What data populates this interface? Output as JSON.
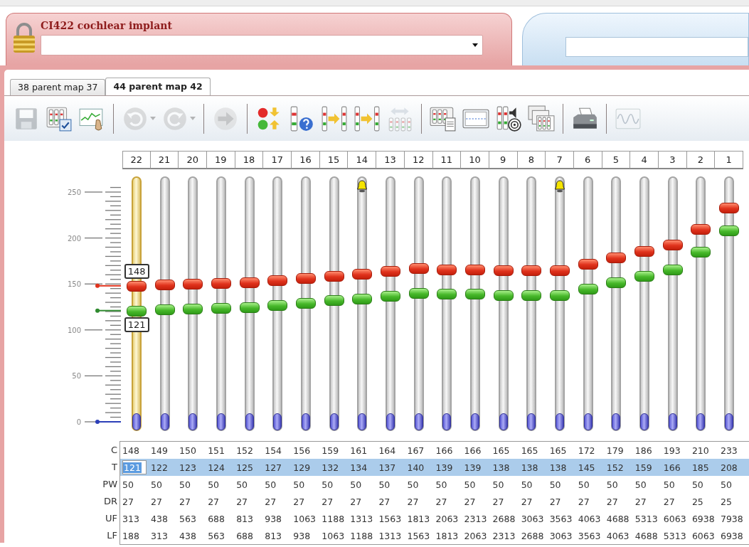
{
  "window": {
    "title": "CI422 cochlear implant"
  },
  "tabs": [
    {
      "label": "38 parent map 37",
      "selected": false
    },
    {
      "label": "44 parent map 42",
      "selected": true
    }
  ],
  "toolbar": [
    {
      "kind": "save",
      "disabled": true
    },
    {
      "kind": "map-check",
      "disabled": false
    },
    {
      "kind": "graph",
      "disabled": false
    },
    {
      "kind": "separator"
    },
    {
      "kind": "undo",
      "disabled": true,
      "menu": true
    },
    {
      "kind": "redo",
      "disabled": true,
      "menu": true
    },
    {
      "kind": "separator"
    },
    {
      "kind": "forward",
      "disabled": true
    },
    {
      "kind": "separator"
    },
    {
      "kind": "levels",
      "disabled": false
    },
    {
      "kind": "slider-help",
      "disabled": false
    },
    {
      "kind": "copy-right",
      "disabled": false
    },
    {
      "kind": "copy-left",
      "disabled": false
    },
    {
      "kind": "spread",
      "disabled": true
    },
    {
      "kind": "separator"
    },
    {
      "kind": "maps-doc",
      "disabled": false
    },
    {
      "kind": "screen",
      "disabled": false
    },
    {
      "kind": "speaker",
      "disabled": false
    },
    {
      "kind": "multi-maps",
      "disabled": false
    },
    {
      "kind": "separator"
    },
    {
      "kind": "printer",
      "disabled": false
    },
    {
      "kind": "separator"
    },
    {
      "kind": "wave",
      "disabled": true
    }
  ],
  "scale": {
    "ticks": [
      "250",
      "200",
      "150",
      "100",
      "50",
      "0"
    ]
  },
  "value_tags": {
    "upper": "148",
    "lower": "121"
  },
  "electrodes": [
    {
      "number": "22",
      "selected": true,
      "bell": false
    },
    {
      "number": "21",
      "selected": false,
      "bell": false
    },
    {
      "number": "20",
      "selected": false,
      "bell": false
    },
    {
      "number": "19",
      "selected": false,
      "bell": false
    },
    {
      "number": "18",
      "selected": false,
      "bell": false
    },
    {
      "number": "17",
      "selected": false,
      "bell": false
    },
    {
      "number": "16",
      "selected": false,
      "bell": false
    },
    {
      "number": "15",
      "selected": false,
      "bell": false
    },
    {
      "number": "14",
      "selected": false,
      "bell": true
    },
    {
      "number": "13",
      "selected": false,
      "bell": false
    },
    {
      "number": "12",
      "selected": false,
      "bell": false
    },
    {
      "number": "11",
      "selected": false,
      "bell": false
    },
    {
      "number": "10",
      "selected": false,
      "bell": false
    },
    {
      "number": "9",
      "selected": false,
      "bell": false
    },
    {
      "number": "8",
      "selected": false,
      "bell": false
    },
    {
      "number": "7",
      "selected": false,
      "bell": true
    },
    {
      "number": "6",
      "selected": false,
      "bell": false
    },
    {
      "number": "5",
      "selected": false,
      "bell": false
    },
    {
      "number": "4",
      "selected": false,
      "bell": false
    },
    {
      "number": "3",
      "selected": false,
      "bell": false
    },
    {
      "number": "2",
      "selected": false,
      "bell": false
    },
    {
      "number": "1",
      "selected": false,
      "bell": false
    }
  ],
  "parameters": [
    {
      "label": "C",
      "selected": false,
      "editing": false,
      "cells": [
        "148",
        "149",
        "150",
        "151",
        "152",
        "154",
        "156",
        "159",
        "161",
        "164",
        "167",
        "166",
        "166",
        "165",
        "165",
        "165",
        "172",
        "179",
        "186",
        "193",
        "210",
        "233"
      ]
    },
    {
      "label": "T",
      "selected": true,
      "editing": true,
      "cells": [
        "121",
        "122",
        "123",
        "124",
        "125",
        "127",
        "129",
        "132",
        "134",
        "137",
        "140",
        "139",
        "139",
        "138",
        "138",
        "138",
        "145",
        "152",
        "159",
        "166",
        "185",
        "208"
      ]
    },
    {
      "label": "PW",
      "selected": false,
      "editing": false,
      "cells": [
        "50",
        "50",
        "50",
        "50",
        "50",
        "50",
        "50",
        "50",
        "50",
        "50",
        "50",
        "50",
        "50",
        "50",
        "50",
        "50",
        "50",
        "50",
        "50",
        "50",
        "50",
        "50"
      ]
    },
    {
      "label": "DR",
      "selected": false,
      "editing": false,
      "cells": [
        "27",
        "27",
        "27",
        "27",
        "27",
        "27",
        "27",
        "27",
        "27",
        "27",
        "27",
        "27",
        "27",
        "27",
        "27",
        "27",
        "27",
        "27",
        "27",
        "27",
        "25",
        "25"
      ]
    },
    {
      "label": "UF",
      "selected": false,
      "editing": false,
      "cells": [
        "313",
        "438",
        "563",
        "688",
        "813",
        "938",
        "1063",
        "1188",
        "1313",
        "1563",
        "1813",
        "2063",
        "2313",
        "2688",
        "3063",
        "3563",
        "4063",
        "4688",
        "5313",
        "6063",
        "6938",
        "7938"
      ]
    },
    {
      "label": "LF",
      "selected": false,
      "editing": false,
      "cells": [
        "188",
        "313",
        "438",
        "563",
        "688",
        "813",
        "938",
        "1063",
        "1188",
        "1313",
        "1563",
        "1813",
        "2063",
        "2313",
        "2688",
        "3063",
        "3563",
        "4063",
        "4688",
        "5313",
        "6063",
        "6938"
      ]
    }
  ]
}
